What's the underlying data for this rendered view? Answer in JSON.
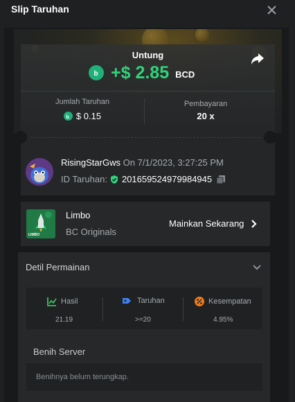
{
  "header": {
    "title": "Slip Taruhan"
  },
  "profit": {
    "label": "Untung",
    "value": "+$ 2.85",
    "currency": "BCD"
  },
  "bet_amount": {
    "label": "Jumlah Taruhan",
    "value": "$ 0.15"
  },
  "payout": {
    "label": "Pembayaran",
    "value": "20 x"
  },
  "user": {
    "name": "RisingStarGws",
    "date": "On 7/1/2023, 3:27:25 PM"
  },
  "bet_id": {
    "label": "ID Taruhan:",
    "value": "201659524979984945"
  },
  "game": {
    "name": "Limbo",
    "provider": "BC Originals",
    "thumb_label": "LIMBO",
    "play_label": "Mainkan Sekarang"
  },
  "details": {
    "title": "Detil Permainan",
    "stats": [
      {
        "label": "Hasil",
        "value": "21.19",
        "icon": "chart-up-icon",
        "color": "#3fbf5f"
      },
      {
        "label": "Taruhan",
        "value": ">=20",
        "icon": "tag-icon",
        "color": "#3b82f6"
      },
      {
        "label": "Kesempatan",
        "value": "4.95%",
        "icon": "percent-icon",
        "color": "#f07a1a"
      }
    ],
    "seed_label": "Benih Server",
    "seed_placeholder": "Benihnya belum terungkap."
  },
  "colors": {
    "accent_green": "#2ed47a",
    "coin_green": "#20b17a",
    "background": "#1e2022"
  }
}
